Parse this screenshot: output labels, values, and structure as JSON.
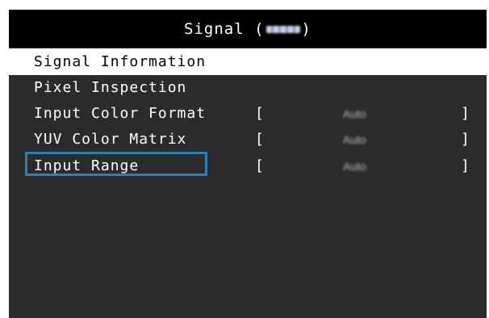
{
  "menu": {
    "title_prefix": "Signal (",
    "title_suffix": ")",
    "title_redacted_icon": "blurred-text"
  },
  "rows": [
    {
      "label": "Signal Information",
      "selected": true
    },
    {
      "label": "Pixel Inspection"
    },
    {
      "label": "Input Color Format",
      "open": "[",
      "value": "Auto",
      "close": "]"
    },
    {
      "label": "YUV Color Matrix",
      "open": "[",
      "value": "Auto",
      "close": "]"
    },
    {
      "label": "Input Range",
      "open": "[",
      "value": "Auto",
      "close": "]",
      "focused": true
    }
  ],
  "colors": {
    "background": "#2b2b2b",
    "title_bar": "#000000",
    "selected_row": "#ffffff",
    "focus_border": "#2d7fb5"
  }
}
